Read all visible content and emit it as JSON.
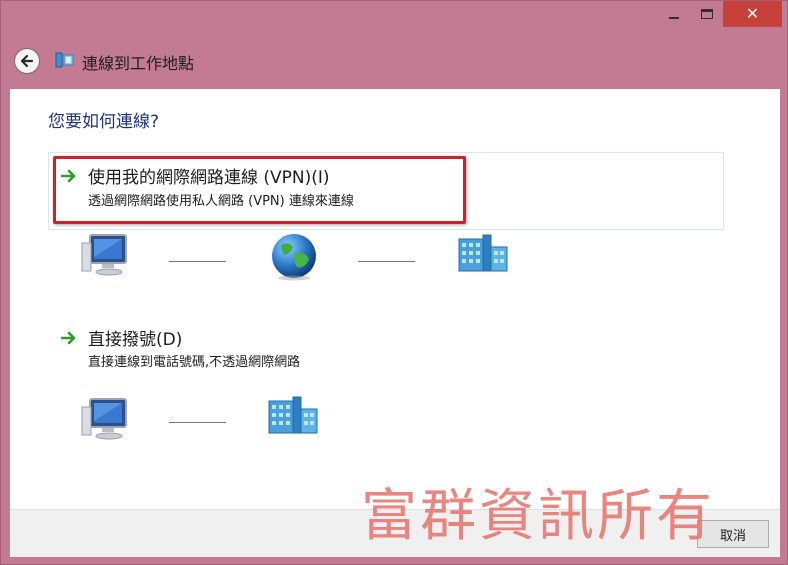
{
  "window": {
    "title": "連線到工作地點",
    "controls": {
      "minimize_icon": "minimize-icon",
      "maximize_icon": "maximize-icon",
      "close_icon": "close-icon"
    }
  },
  "main": {
    "question": "您要如何連線?",
    "options": [
      {
        "title": "使用我的網際網路連線 (VPN)(I)",
        "description": "透過網際網路使用私人網路 (VPN) 連線來連線",
        "diagram": [
          "computer-icon",
          "globe-icon",
          "office-building-icon"
        ]
      },
      {
        "title": "直接撥號(D)",
        "description": "直接連線到電話號碼,不透過網際網路",
        "diagram": [
          "computer-icon",
          "office-building-icon"
        ]
      }
    ]
  },
  "watermark": "富群資訊所有",
  "footer": {
    "cancel_label": "取消"
  },
  "colors": {
    "window_frame": "#c27b92",
    "close_button": "#c7403a",
    "highlight_border": "#c8242a",
    "question_text": "#1e3287",
    "arrow_green": "#2aa02a",
    "watermark": "#e8766e"
  }
}
